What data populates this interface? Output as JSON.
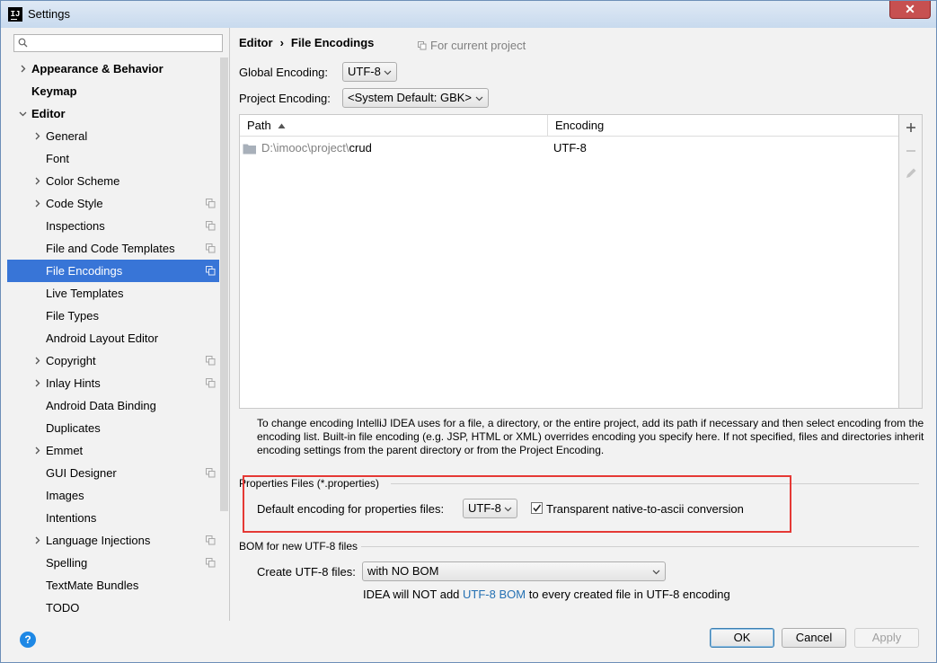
{
  "window": {
    "title": "Settings",
    "app_icon": "IJ"
  },
  "sidebar": {
    "search_placeholder": "",
    "items": [
      {
        "label": "Appearance & Behavior",
        "level": 0,
        "expandable": true,
        "expanded": false,
        "bold": true,
        "copy": false
      },
      {
        "label": "Keymap",
        "level": 0,
        "expandable": false,
        "bold": true,
        "copy": false
      },
      {
        "label": "Editor",
        "level": 0,
        "expandable": true,
        "expanded": true,
        "bold": true,
        "copy": false
      },
      {
        "label": "General",
        "level": 1,
        "expandable": true,
        "expanded": false,
        "copy": false
      },
      {
        "label": "Font",
        "level": 1,
        "expandable": false,
        "copy": false
      },
      {
        "label": "Color Scheme",
        "level": 1,
        "expandable": true,
        "expanded": false,
        "copy": false
      },
      {
        "label": "Code Style",
        "level": 1,
        "expandable": true,
        "expanded": false,
        "copy": true
      },
      {
        "label": "Inspections",
        "level": 1,
        "expandable": false,
        "copy": true
      },
      {
        "label": "File and Code Templates",
        "level": 1,
        "expandable": false,
        "copy": true
      },
      {
        "label": "File Encodings",
        "level": 1,
        "expandable": false,
        "copy": true,
        "selected": true
      },
      {
        "label": "Live Templates",
        "level": 1,
        "expandable": false,
        "copy": false
      },
      {
        "label": "File Types",
        "level": 1,
        "expandable": false,
        "copy": false
      },
      {
        "label": "Android Layout Editor",
        "level": 1,
        "expandable": false,
        "copy": false
      },
      {
        "label": "Copyright",
        "level": 1,
        "expandable": true,
        "expanded": false,
        "copy": true
      },
      {
        "label": "Inlay Hints",
        "level": 1,
        "expandable": true,
        "expanded": false,
        "copy": true
      },
      {
        "label": "Android Data Binding",
        "level": 1,
        "expandable": false,
        "copy": false
      },
      {
        "label": "Duplicates",
        "level": 1,
        "expandable": false,
        "copy": false
      },
      {
        "label": "Emmet",
        "level": 1,
        "expandable": true,
        "expanded": false,
        "copy": false
      },
      {
        "label": "GUI Designer",
        "level": 1,
        "expandable": false,
        "copy": true
      },
      {
        "label": "Images",
        "level": 1,
        "expandable": false,
        "copy": false
      },
      {
        "label": "Intentions",
        "level": 1,
        "expandable": false,
        "copy": false
      },
      {
        "label": "Language Injections",
        "level": 1,
        "expandable": true,
        "expanded": false,
        "copy": true
      },
      {
        "label": "Spelling",
        "level": 1,
        "expandable": false,
        "copy": true
      },
      {
        "label": "TextMate Bundles",
        "level": 1,
        "expandable": false,
        "copy": false
      },
      {
        "label": "TODO",
        "level": 1,
        "expandable": false,
        "copy": false
      }
    ]
  },
  "main": {
    "breadcrumb": [
      "Editor",
      "File Encodings"
    ],
    "breadcrumb_separator": "›",
    "scope_note": "For current project",
    "global_encoding": {
      "label": "Global Encoding:",
      "value": "UTF-8"
    },
    "project_encoding": {
      "label": "Project Encoding:",
      "value": "<System Default: GBK>"
    },
    "table": {
      "columns": [
        {
          "label": "Path",
          "sort": "ascending"
        },
        {
          "label": "Encoding"
        }
      ],
      "rows": [
        {
          "path_prefix": "D:\\imooc\\project\\",
          "path_name": "crud",
          "encoding": "UTF-8"
        }
      ]
    },
    "help_text": "To change encoding IntelliJ IDEA uses for a file, a directory, or the entire project, add its path if necessary and then select encoding from the encoding list. Built-in file encoding (e.g. JSP, HTML or XML) overrides encoding you specify here. If not specified, files and directories inherit encoding settings from the parent directory or from the Project Encoding.",
    "properties_section": {
      "title": "Properties Files (*.properties)",
      "default_label": "Default encoding for properties files:",
      "default_value": "UTF-8",
      "native_to_ascii_label": "Transparent native-to-ascii conversion",
      "native_to_ascii_checked": true
    },
    "bom_section": {
      "title": "BOM for new UTF-8 files",
      "create_label": "Create UTF-8 files:",
      "create_value": "with NO BOM",
      "note_prefix": "IDEA will NOT add ",
      "note_link": "UTF-8 BOM",
      "note_suffix": " to every created file in UTF-8 encoding"
    }
  },
  "footer": {
    "ok": "OK",
    "cancel": "Cancel",
    "apply": "Apply",
    "help": "?"
  },
  "colors": {
    "selection": "#3875d7",
    "highlight_box": "#e53935",
    "link": "#2470b3",
    "help_button": "#1e88e5"
  }
}
